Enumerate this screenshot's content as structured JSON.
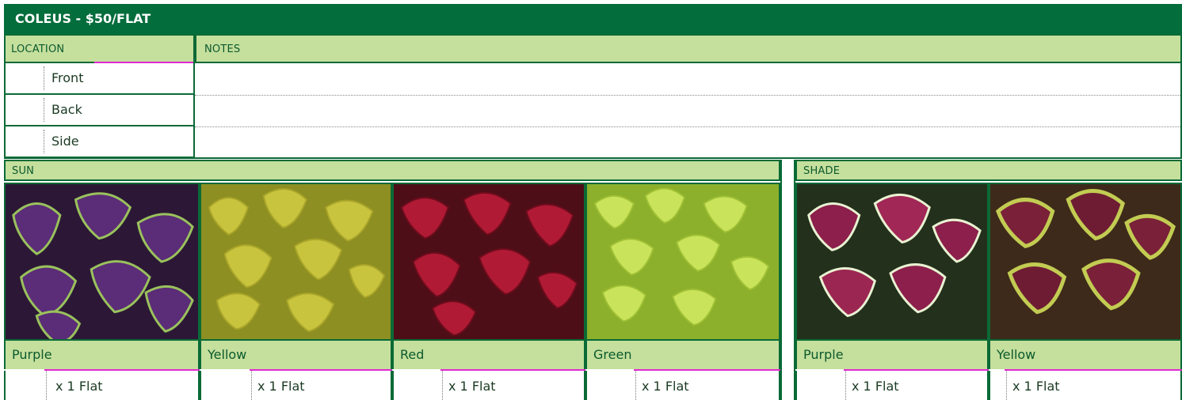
{
  "header": {
    "title": "COLEUS - $50/FLAT"
  },
  "location": {
    "label": "LOCATION",
    "rows": [
      "Front",
      "Back",
      "Side"
    ]
  },
  "notes": {
    "label": "NOTES"
  },
  "sun": {
    "label": "SUN",
    "items": [
      {
        "name": "Purple",
        "qty": "x 1 Flat"
      },
      {
        "name": "Yellow",
        "qty": "x 1 Flat"
      },
      {
        "name": "Red",
        "qty": "x 1 Flat"
      },
      {
        "name": "Green",
        "qty": "x 1 Flat"
      }
    ]
  },
  "shade": {
    "label": "SHADE",
    "items": [
      {
        "name": "Purple",
        "qty": "x 1 Flat"
      },
      {
        "name": "Yellow",
        "qty": "x 1 Flat"
      }
    ]
  },
  "colors": {
    "header_green": "#036d3c",
    "light_green": "#c5df9d",
    "accent_magenta": "#e02bd0"
  }
}
